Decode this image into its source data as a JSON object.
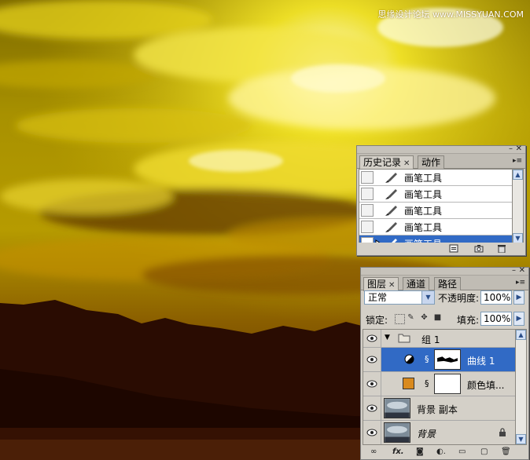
{
  "watermark": "思缘设计论坛 www.MISSYUAN.COM",
  "history_panel": {
    "tabs": [
      {
        "label": "历史记录",
        "active": true
      },
      {
        "label": "动作",
        "active": false
      }
    ],
    "items": [
      {
        "label": "画笔工具",
        "selected": false
      },
      {
        "label": "画笔工具",
        "selected": false
      },
      {
        "label": "画笔工具",
        "selected": false
      },
      {
        "label": "画笔工具",
        "selected": false
      },
      {
        "label": "画笔工具",
        "selected": true
      }
    ],
    "footer_icons": [
      "new-document-from-state-icon",
      "snapshot-camera-icon",
      "trash-icon"
    ]
  },
  "layers_panel": {
    "tabs": [
      {
        "label": "图层",
        "active": true
      },
      {
        "label": "通道",
        "active": false
      },
      {
        "label": "路径",
        "active": false
      }
    ],
    "blend_mode": "正常",
    "opacity_label": "不透明度:",
    "opacity_value": "100%",
    "lock_label": "锁定:",
    "fill_label": "填充:",
    "fill_value": "100%",
    "layers": [
      {
        "name": "组 1",
        "kind": "group",
        "visible": true,
        "selected": false
      },
      {
        "name": "曲线 1",
        "kind": "adjustment",
        "visible": true,
        "selected": true
      },
      {
        "name": "颜色填...",
        "kind": "fill",
        "visible": true,
        "selected": false,
        "swatch": "#d98a1e"
      },
      {
        "name": "背景 副本",
        "kind": "image",
        "visible": true,
        "selected": false
      },
      {
        "name": "背景",
        "kind": "background",
        "visible": true,
        "selected": false,
        "locked": true
      }
    ],
    "footer_icons": [
      "link-icon",
      "fx-icon",
      "mask-icon",
      "adjustment-icon",
      "folder-icon",
      "new-layer-icon",
      "trash-icon"
    ]
  },
  "colors": {
    "selection": "#316ac5",
    "panel": "#d4d0c8"
  }
}
